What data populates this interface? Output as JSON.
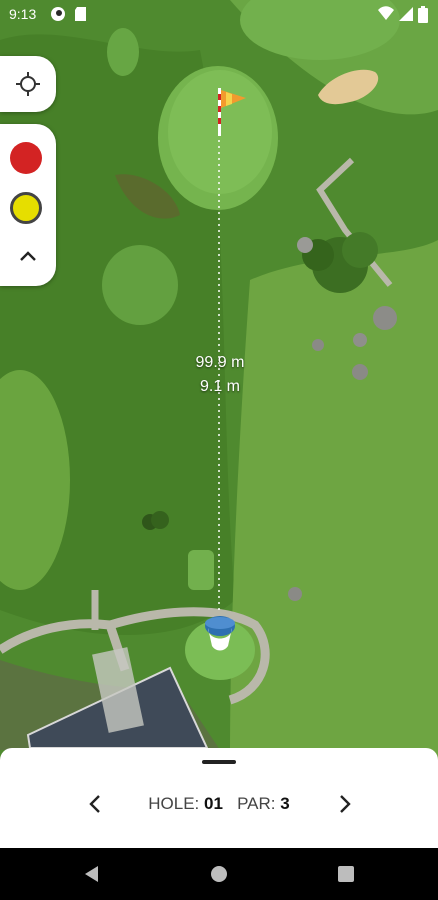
{
  "status_bar": {
    "time": "9:13",
    "icons": [
      "app-icon",
      "sd-card-icon",
      "wifi-icon",
      "signal-icon",
      "battery-icon"
    ]
  },
  "map": {
    "measurement": {
      "distance_primary": "99.9 m",
      "distance_secondary": "9.1 m"
    },
    "flag_icon": "flag-icon",
    "player_marker_icon": "player-position-icon"
  },
  "controls": {
    "locate_icon": "crosshair-icon",
    "markers": [
      {
        "name": "red-marker",
        "color": "#d32323"
      },
      {
        "name": "yellow-marker",
        "color": "#e6de00"
      }
    ],
    "collapse_icon": "chevron-up-icon"
  },
  "bottom_sheet": {
    "hole_label": "HOLE:",
    "hole_number": "01",
    "par_label": "PAR:",
    "par_value": "3",
    "prev_icon": "chevron-left-icon",
    "next_icon": "chevron-right-icon"
  },
  "nav_bar": {
    "icons": [
      "back-icon",
      "home-icon",
      "recents-icon"
    ]
  },
  "colors": {
    "rough": "#4f8a2f",
    "fairway": "#67a640",
    "green": "#79bb52",
    "sheet_bg": "#ffffff"
  }
}
